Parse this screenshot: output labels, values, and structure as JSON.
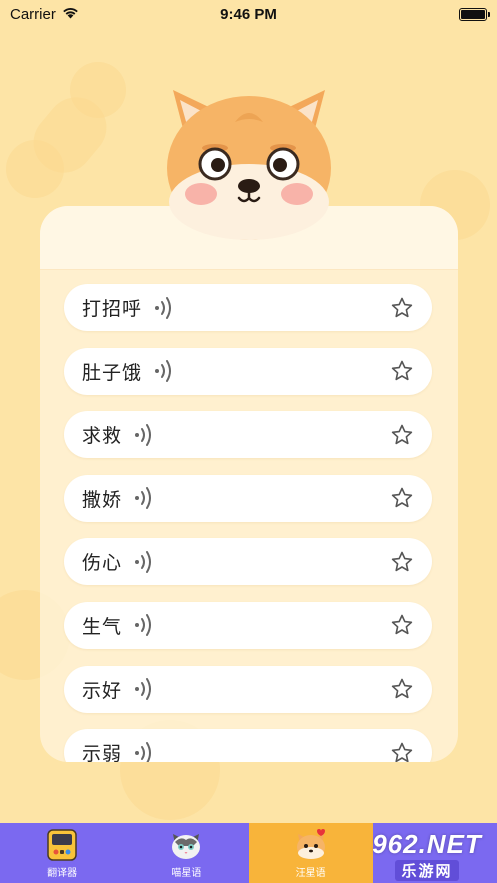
{
  "status_bar": {
    "carrier": "Carrier",
    "time": "9:46 PM"
  },
  "items": [
    {
      "label": "打招呼"
    },
    {
      "label": "肚子饿"
    },
    {
      "label": "求救"
    },
    {
      "label": "撒娇"
    },
    {
      "label": "伤心"
    },
    {
      "label": "生气"
    },
    {
      "label": "示好"
    },
    {
      "label": "示弱"
    }
  ],
  "tabs": [
    {
      "label": "翻译器",
      "icon": "translator-icon"
    },
    {
      "label": "喵星语",
      "icon": "cat-icon"
    },
    {
      "label": "汪星语",
      "icon": "dog-icon",
      "active": true
    },
    {
      "label": "",
      "icon": "tab-icon"
    }
  ],
  "watermark": {
    "main": "962.NET",
    "sub": "乐游网"
  },
  "colors": {
    "background": "#fde4a6",
    "tab_bar": "#7b69f0",
    "tab_active": "#f8b43a",
    "card": "#fff4dc"
  }
}
